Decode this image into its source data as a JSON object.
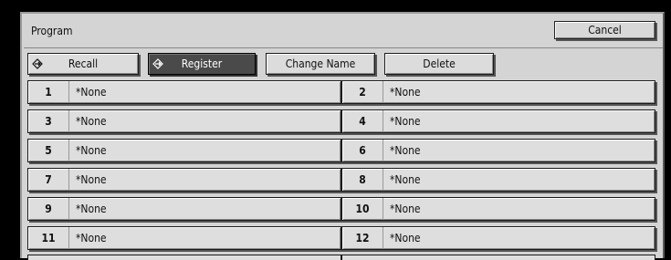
{
  "title": "Program",
  "cancel_label": "Cancel",
  "toolbar": {
    "recall_label": "Recall",
    "register_label": "Register",
    "change_name_label": "Change Name",
    "delete_label": "Delete"
  },
  "selected_mode": "Register",
  "programs": [
    {
      "number": "1",
      "name": "*None"
    },
    {
      "number": "2",
      "name": "*None"
    },
    {
      "number": "3",
      "name": "*None"
    },
    {
      "number": "4",
      "name": "*None"
    },
    {
      "number": "5",
      "name": "*None"
    },
    {
      "number": "6",
      "name": "*None"
    },
    {
      "number": "7",
      "name": "*None"
    },
    {
      "number": "8",
      "name": "*None"
    },
    {
      "number": "9",
      "name": "*None"
    },
    {
      "number": "10",
      "name": "*None"
    },
    {
      "number": "11",
      "name": "*None"
    },
    {
      "number": "12",
      "name": "*None"
    }
  ]
}
